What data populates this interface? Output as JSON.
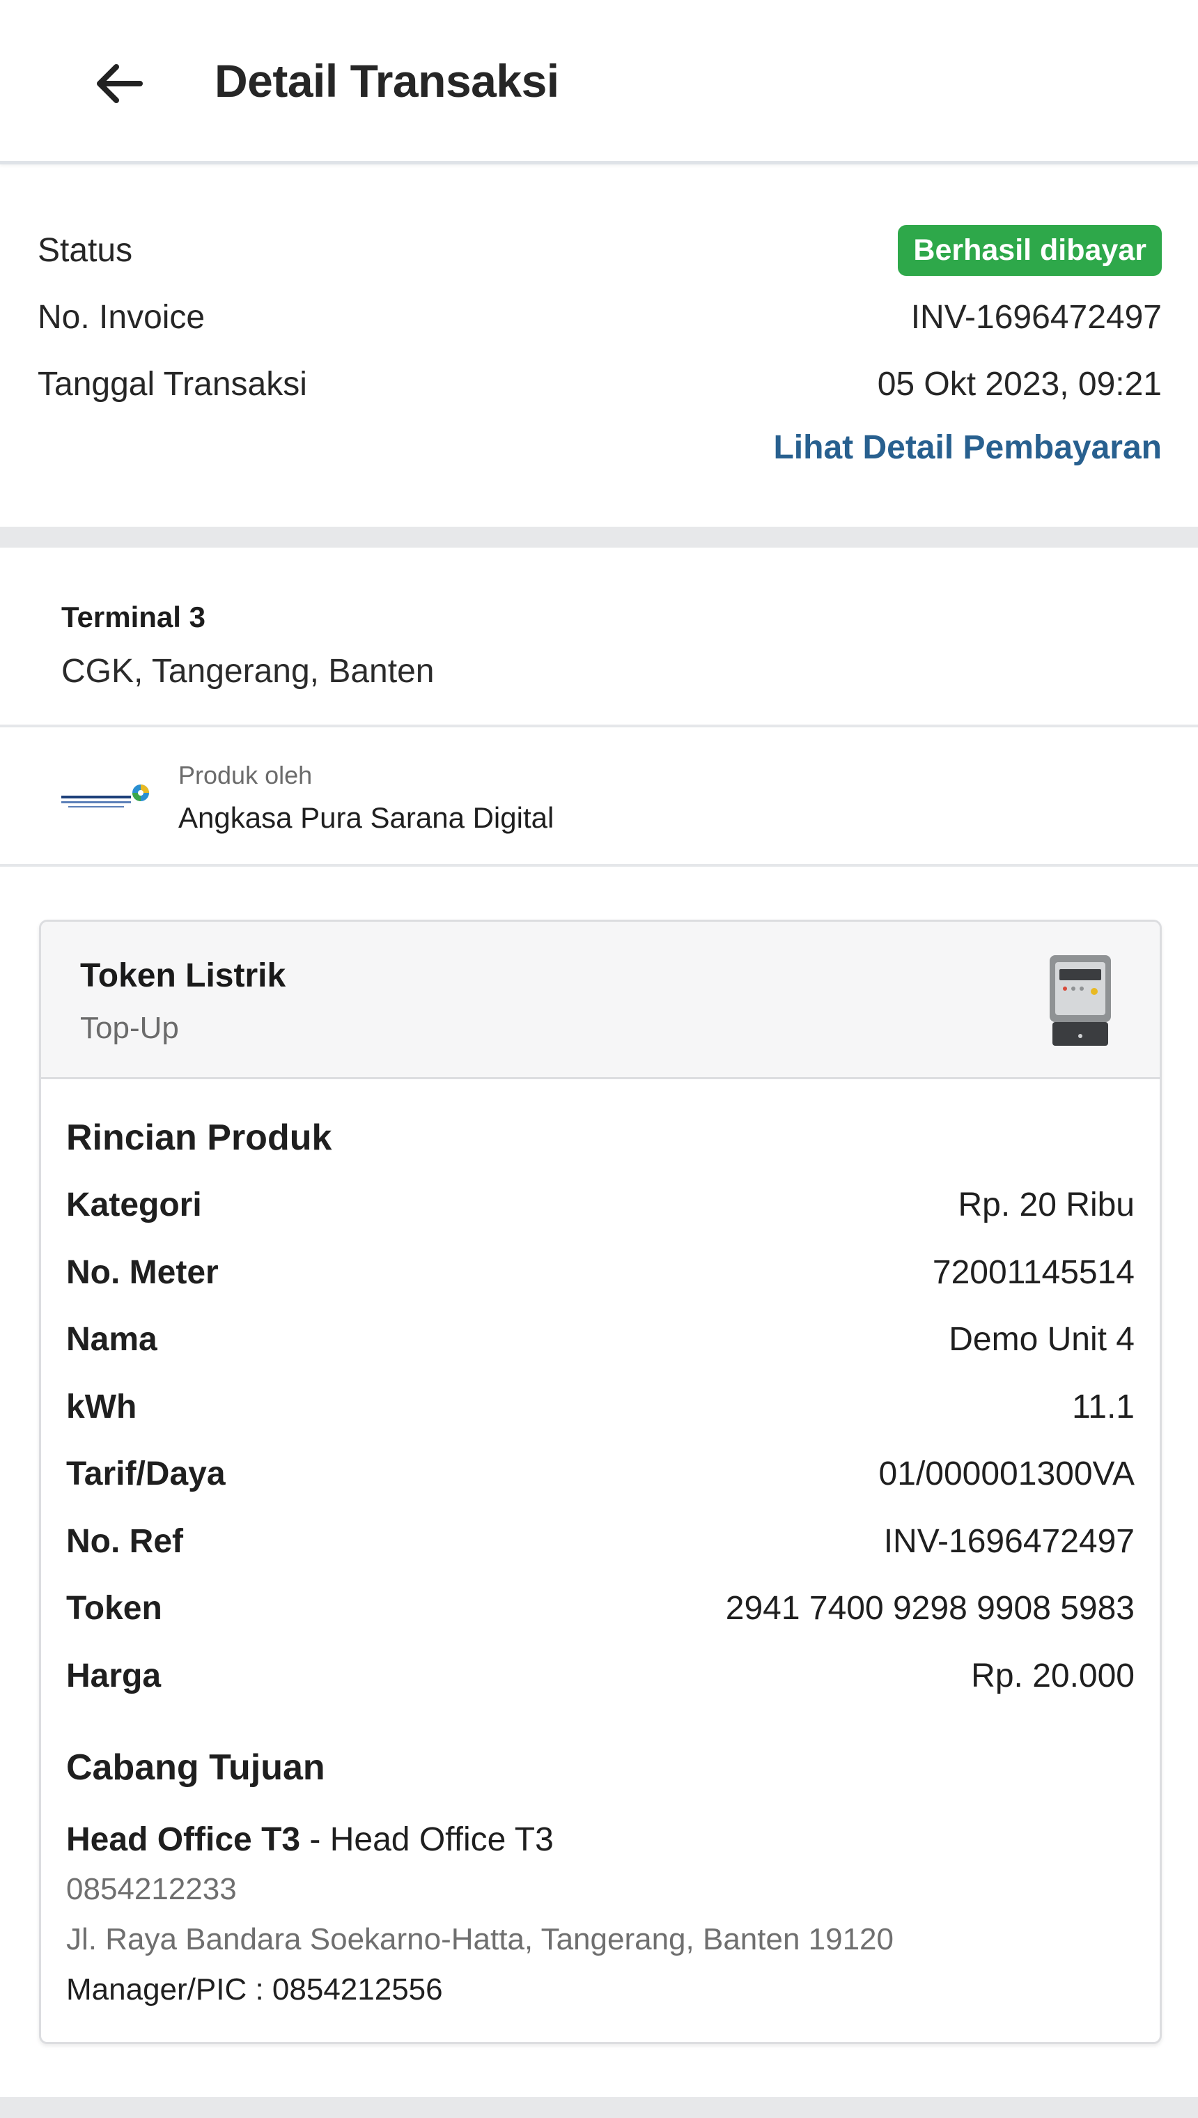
{
  "header": {
    "back_icon": "arrow-left-icon",
    "title": "Detail Transaksi"
  },
  "summary": {
    "status_label": "Status",
    "status_value": "Berhasil dibayar",
    "status_color": "#2ea84a",
    "invoice_label": "No. Invoice",
    "invoice_value": "INV-1696472497",
    "date_label": "Tanggal Transaksi",
    "date_value": "05 Okt 2023, 09:21",
    "payment_link": "Lihat Detail Pembayaran",
    "link_color": "#28608f"
  },
  "location": {
    "name": "Terminal 3",
    "address": "CGK, Tangerang, Banten"
  },
  "provider": {
    "logo_icon": "angkasa-pura-logo",
    "label": "Produk oleh",
    "name": "Angkasa Pura Sarana Digital"
  },
  "product": {
    "title": "Token Listrik",
    "subtitle": "Top-Up",
    "icon": "electric-meter-icon"
  },
  "details": {
    "title": "Rincian Produk",
    "rows": [
      {
        "label": "Kategori",
        "value": "Rp. 20 Ribu"
      },
      {
        "label": "No. Meter",
        "value": "72001145514"
      },
      {
        "label": "Nama",
        "value": "Demo Unit 4"
      },
      {
        "label": "kWh",
        "value": "11.1"
      },
      {
        "label": "Tarif/Daya",
        "value": "01/000001300VA"
      },
      {
        "label": "No. Ref",
        "value": "INV-1696472497"
      },
      {
        "label": "Token",
        "value": "2941 7400 9298 9908 5983"
      },
      {
        "label": "Harga",
        "value": "Rp. 20.000"
      }
    ]
  },
  "branch": {
    "title": "Cabang Tujuan",
    "name": "Head Office T3",
    "separator": " - ",
    "office": "Head Office T3",
    "phone": "0854212233",
    "address": "Jl. Raya Bandara Soekarno-Hatta, Tangerang, Banten 19120",
    "pic": "Manager/PIC : 0854212556"
  }
}
